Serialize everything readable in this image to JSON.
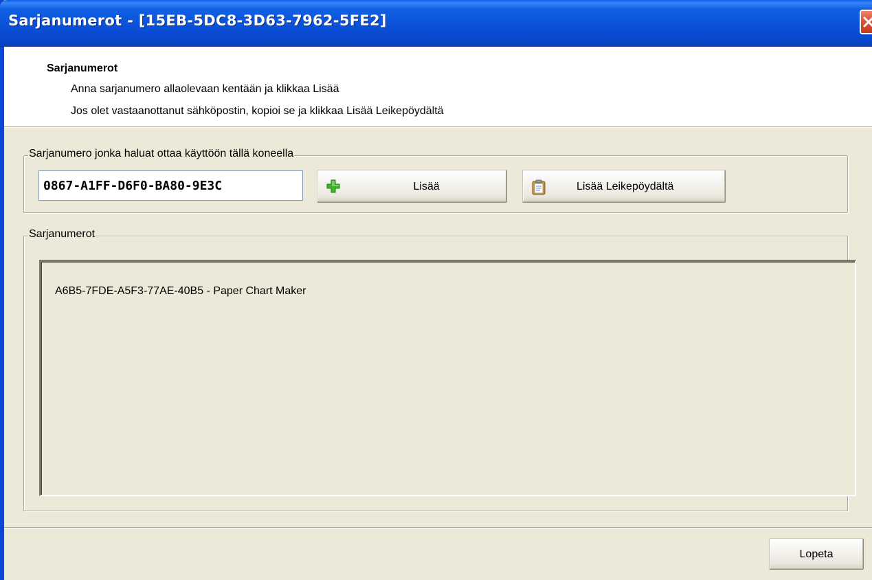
{
  "window": {
    "title": "Sarjanumerot - [15EB-5DC8-3D63-7962-5FE2]"
  },
  "header": {
    "title": "Sarjanumerot",
    "line1": "Anna sarjanumero allaolevaan kentään ja klikkaa Lisää",
    "line2": "Jos olet vastaanottanut sähköpostin, kopioi se ja klikkaa Lisää Leikepöydältä"
  },
  "entry_group": {
    "legend": "Sarjanumero jonka haluat ottaa käyttöön tällä koneella",
    "serial_value": "0867-A1FF-D6F0-BA80-9E3C",
    "add_button": {
      "label": "Lisää",
      "icon": "green-plus-icon"
    },
    "clipboard_button": {
      "label": "Lisää Leikepöydältä",
      "icon": "clipboard-icon"
    }
  },
  "serials_group": {
    "legend": "Sarjanumerot",
    "items": [
      "A6B5-7FDE-A5F3-77AE-40B5 - Paper Chart Maker"
    ]
  },
  "footer": {
    "quit_label": "Lopeta"
  },
  "colors": {
    "titlebar": "#0a4fd6",
    "dialog_bg": "#ece9d8",
    "close_button": "#e0553a"
  }
}
